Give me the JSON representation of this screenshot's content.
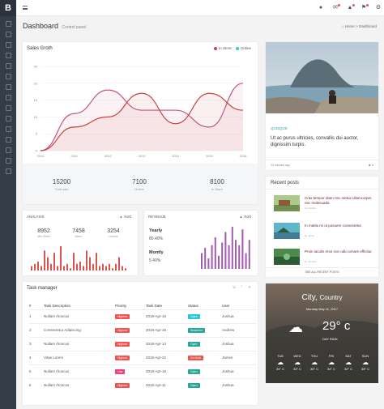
{
  "app": {
    "logo": "B"
  },
  "sidebar": {
    "icons": [
      "home-icon",
      "dashboard-icon",
      "apps-icon",
      "mail-icon",
      "calendar-icon",
      "widgets-icon",
      "chart-icon",
      "layers-icon",
      "table-icon",
      "list-icon",
      "map-icon",
      "pages-icon",
      "star-icon",
      "document-icon",
      "arrow-icon"
    ]
  },
  "topbar": {
    "icons": [
      "user-icon",
      "mail-icon",
      "bell-icon",
      "flag-icon",
      "gear-icon"
    ]
  },
  "page": {
    "title": "Dashboard",
    "subtitle": "Control panel",
    "breadcrumb_home": "Home",
    "breadcrumb_sep": ">",
    "breadcrumb_current": "Dashboard"
  },
  "sales": {
    "title": "Sales Groth",
    "legend": [
      {
        "label": "In Store",
        "color": "#c1417f"
      },
      {
        "label": "Online",
        "color": "#3dc3d6"
      }
    ],
    "stats": [
      {
        "value": "15200",
        "label": "Total sale"
      },
      {
        "value": "7100",
        "label": "Online"
      },
      {
        "value": "8100",
        "label": "In Store"
      }
    ]
  },
  "chart_data": [
    {
      "type": "line",
      "title": "Sales Groth",
      "x": [
        2010,
        2011,
        2012,
        2013,
        2014,
        2015,
        2016
      ],
      "ylim": [
        0,
        25
      ],
      "yticks": [
        0,
        5,
        10,
        15,
        20,
        25
      ],
      "series": [
        {
          "name": "In Store",
          "color": "#c6537f",
          "values": [
            0,
            11,
            18,
            12,
            12,
            7,
            20
          ]
        },
        {
          "name": "Online",
          "color": "#cf3c3c",
          "values": [
            0,
            7,
            10,
            17,
            8,
            17,
            12
          ]
        }
      ]
    },
    {
      "type": "bar",
      "title": "ANALYSIS",
      "values": [
        2,
        3,
        4,
        2,
        9,
        6,
        3,
        8,
        2,
        11,
        2,
        3,
        1,
        8,
        3,
        4,
        2,
        9,
        6,
        3,
        8,
        2,
        3,
        2,
        3,
        1,
        3,
        6,
        2,
        1
      ]
    },
    {
      "type": "bar",
      "title": "REVENUE",
      "values": [
        6,
        8,
        4,
        9,
        12,
        5,
        10,
        14,
        9,
        16,
        11,
        9,
        15,
        6,
        11
      ]
    }
  ],
  "analysis": {
    "title": "ANALYSIS",
    "change": "%20",
    "stats": [
      {
        "value": "8952",
        "label": "Mio Shikh"
      },
      {
        "value": "7458",
        "label": "Mauri"
      },
      {
        "value": "3254",
        "label": "London"
      }
    ]
  },
  "revenue": {
    "title": "REVENUE",
    "change": "%20",
    "yearly_label": "Yearly",
    "yearly_value": "80.40%",
    "monthly_label": "Montly",
    "monthly_value": "5.40%"
  },
  "feature": {
    "tag": "QUISQUE",
    "text": "Ut ac purus ultricies, convallis dui auctor, dignissim turpis.",
    "time": "20 minutes ago",
    "comments": "6"
  },
  "recent": {
    "title": "Recent posts",
    "posts": [
      {
        "text": "Cras tempor diam nec metus ullamcorper, nec malesuada",
        "author": "by Foratia"
      },
      {
        "text": "In mattis mi ut posuere consectetur.",
        "author": "by Jaime"
      },
      {
        "text": "Proin iaculis eros non odio ornare efficitur.",
        "author": "by Jenunta"
      }
    ],
    "link": "SEE ALL RECENT POSTS"
  },
  "tasks": {
    "title": "Task manager",
    "headers": [
      "#",
      "Task Description",
      "Priority",
      "Task Date",
      "Status",
      "User"
    ],
    "rows": [
      {
        "n": "1",
        "task": "Nullam rhoncus",
        "priority": "Highest",
        "pcolor": "#ef5350",
        "date": "2019-Apr-16",
        "status": "Open",
        "scolor": "#26c6da",
        "user": "Joshua"
      },
      {
        "n": "2",
        "task": "Consectetur Adipiscing",
        "priority": "Highest",
        "pcolor": "#ef5350",
        "date": "2019-Apr-15",
        "status": "Resolved",
        "scolor": "#26a69a",
        "user": "Andrew"
      },
      {
        "n": "3",
        "task": "Nullam rhoncus",
        "priority": "Highest",
        "pcolor": "#ef5350",
        "date": "2019-Apr-14",
        "status": "Open",
        "scolor": "#26a69a",
        "user": "Joshua"
      },
      {
        "n": "4",
        "task": "Vitae Lorem",
        "priority": "Highest",
        "pcolor": "#ef5350",
        "date": "2019-Apr-22",
        "status": "On Hold",
        "scolor": "#ef5350",
        "user": "James"
      },
      {
        "n": "5",
        "task": "Nullam rhoncus",
        "priority": "Low",
        "pcolor": "#ec407a",
        "date": "2019-Apr-16",
        "status": "Open",
        "scolor": "#26a69a",
        "user": "Joshua"
      },
      {
        "n": "6",
        "task": "Nullam rhoncus",
        "priority": "Highest",
        "pcolor": "#ef5350",
        "date": "2019-Apr-11",
        "status": "Open",
        "scolor": "#26a69a",
        "user": "Joshua"
      }
    ]
  },
  "weather": {
    "city": "City,",
    "country": "Country",
    "date": "Monday May 11, 2017",
    "temp": "29° c",
    "desc": "DAY RAIN",
    "days": [
      {
        "d": "TUE",
        "t": "34° C"
      },
      {
        "d": "WED",
        "t": "33° C"
      },
      {
        "d": "THU",
        "t": "36° C"
      },
      {
        "d": "FRI",
        "t": "34° C"
      },
      {
        "d": "SAT",
        "t": "32° C"
      },
      {
        "d": "SUN",
        "t": "38° C"
      }
    ]
  }
}
